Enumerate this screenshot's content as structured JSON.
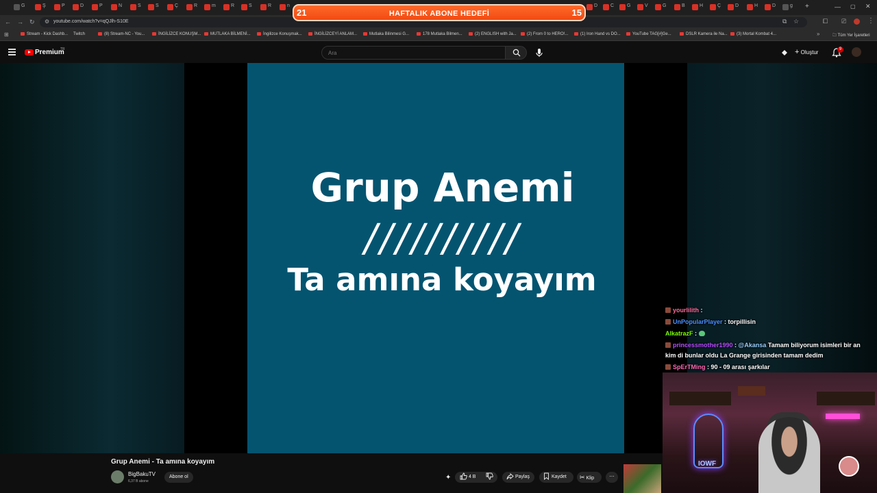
{
  "browser": {
    "tab_letters": [
      "G",
      "Ş",
      "P",
      "D",
      "P",
      "N",
      "S",
      "S",
      "Ç",
      "R",
      "m",
      "R",
      "S",
      "R",
      "n",
      "D",
      "C",
      "G",
      "V",
      "G",
      "B",
      "H",
      "Ç",
      "D",
      "H",
      "D",
      "g"
    ],
    "url": "youtube.com/watch?v=qQJlh-S10E",
    "bookmarks": [
      "Stream - Kick Dashb...",
      "Twitch",
      "(8) Stream-NC - You...",
      "İNGİLİZCE KONUŞM...",
      "MUTLAKA BİLMENİ...",
      "İngilizce Konuşmak...",
      "İNGİLİZCEYİ ANLAM...",
      "Mutlaka Bilinmesi G...",
      "178 Mutlaka Bilmen...",
      "(2) ENGLISH with Ja...",
      "(2) From 0 to HERO!...",
      "(1) Iron Hand vs DO...",
      "YouTube TAG[#]Ge...",
      "DSLR Kamera ile Na...",
      "(3) Mortal Kombat 4..."
    ],
    "all_bookmarks": "Tüm Yer İşaretleri"
  },
  "overlay_goal": {
    "left_count": "21",
    "label": "HAFTALIK ABONE HEDEFİ",
    "right_count": "15"
  },
  "youtube": {
    "logo_label": "Premium",
    "region": "TR",
    "search_placeholder": "Ara",
    "create_label": "Oluştur",
    "notif_count": "9"
  },
  "video": {
    "line1": "Grup Anemi",
    "line2": "//////////",
    "line3": "Ta amına koyayım",
    "title": "Grup Anemi - Ta amına koyayım",
    "channel": "BigBakuTV",
    "subscribers": "6,37 B abone",
    "subscribe_label": "Abone ol",
    "like_count": "4 B",
    "share_label": "Paylaş",
    "save_label": "Kaydet",
    "clip_label": "Klip"
  },
  "chat": [
    {
      "user": "yourlilith",
      "text": ""
    },
    {
      "user": "UnPopularPlayer",
      "text": "torpillisin"
    },
    {
      "user": "AlkatrazF",
      "text": ""
    },
    {
      "user": "princessmother1990",
      "mention": "@Akansa",
      "text": "Tamam biliyorum isimleri bir an",
      "text2": "kim di bunlar oldu La Grange girisinden tamam dedim"
    },
    {
      "user": "SpErTMing",
      "text": "90 - 09 arası şarkılar"
    }
  ],
  "webcam": {
    "neon_text": "IOWF"
  }
}
